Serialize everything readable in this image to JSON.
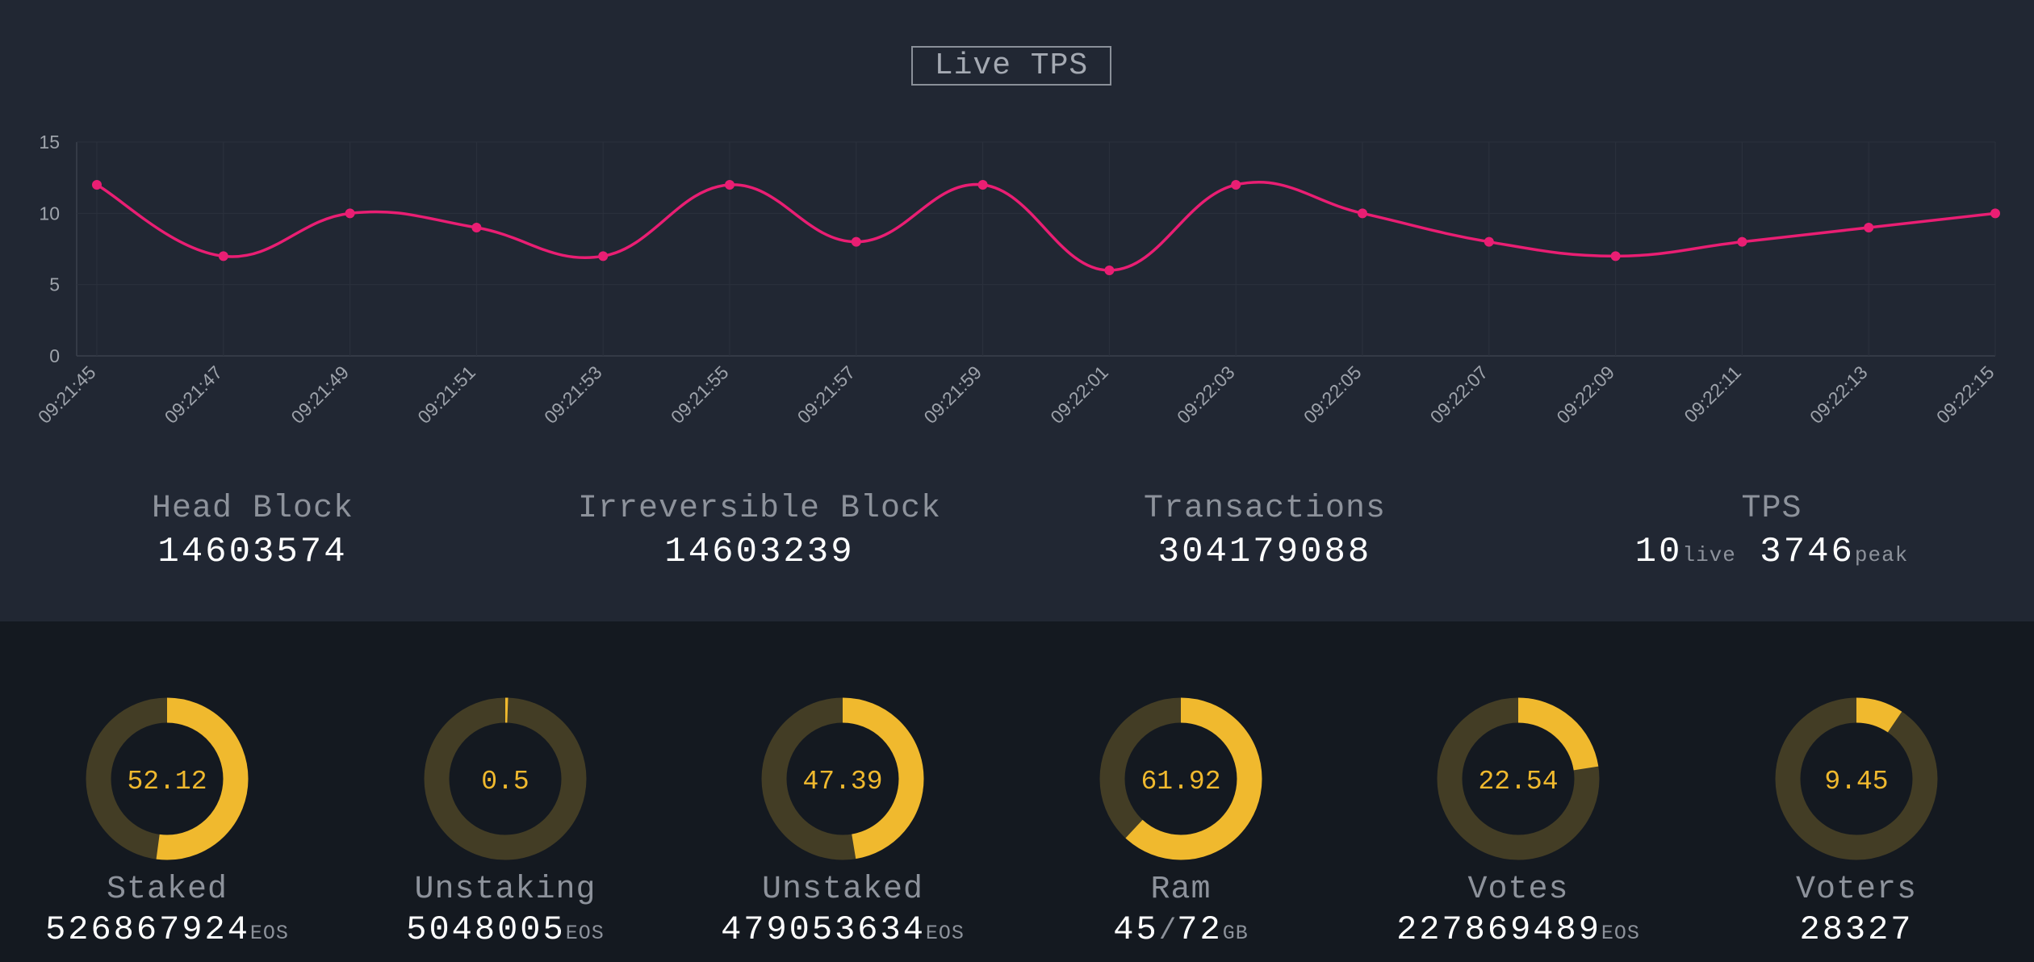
{
  "header": {
    "title": "Live TPS"
  },
  "chart_data": {
    "type": "line",
    "categories": [
      "09:21:45",
      "09:21:47",
      "09:21:49",
      "09:21:51",
      "09:21:53",
      "09:21:55",
      "09:21:57",
      "09:21:59",
      "09:22:01",
      "09:22:03",
      "09:22:05",
      "09:22:07",
      "09:22:09",
      "09:22:11",
      "09:22:13",
      "09:22:15"
    ],
    "series": [
      {
        "values": [
          12,
          7,
          10,
          9,
          7,
          12,
          8,
          12,
          6,
          12,
          10,
          8,
          7,
          8,
          9,
          10
        ]
      }
    ],
    "ylim": [
      0,
      15
    ],
    "yticks": [
      "0",
      "5",
      "10",
      "15"
    ],
    "grid": true,
    "line_color": "#e91e73"
  },
  "stats": [
    {
      "label": "Head Block",
      "value": "14603574"
    },
    {
      "label": "Irreversible Block",
      "value": "14603239"
    },
    {
      "label": "Transactions",
      "value": "304179088"
    },
    {
      "label": "TPS",
      "live": "10",
      "live_unit": "live",
      "peak": "3746",
      "peak_unit": "peak"
    }
  ],
  "gauges": [
    {
      "percent": 52.12,
      "text": "52.12",
      "label": "Staked",
      "value": "526867924",
      "unit": "EOS"
    },
    {
      "percent": 0.5,
      "text": "0.5",
      "label": "Unstaking",
      "value": "5048005",
      "unit": "EOS"
    },
    {
      "percent": 47.39,
      "text": "47.39",
      "label": "Unstaked",
      "value": "479053634",
      "unit": "EOS"
    },
    {
      "percent": 61.92,
      "text": "61.92",
      "label": "Ram",
      "value": "45",
      "sep": "/",
      "value2": "72",
      "unit": "GB"
    },
    {
      "percent": 22.54,
      "text": "22.54",
      "label": "Votes",
      "value": "227869489",
      "unit": "EOS"
    },
    {
      "percent": 9.45,
      "text": "9.45",
      "label": "Voters",
      "value": "28327",
      "unit": ""
    }
  ],
  "colors": {
    "accent": "#f0b92e",
    "track": "#433d25",
    "line": "#e91e73"
  }
}
